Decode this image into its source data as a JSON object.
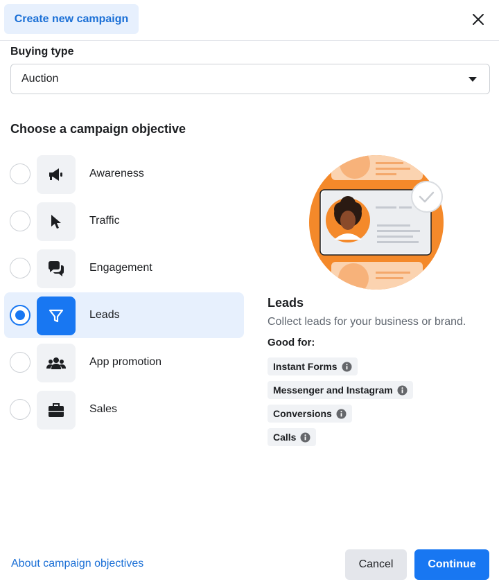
{
  "header": {
    "tab_label": "Create new campaign",
    "close_icon": "close-icon"
  },
  "buying_type": {
    "label": "Buying type",
    "value": "Auction"
  },
  "objectives": {
    "title": "Choose a campaign objective",
    "selected": "Leads",
    "items": [
      {
        "label": "Awareness",
        "icon": "megaphone-icon"
      },
      {
        "label": "Traffic",
        "icon": "cursor-icon"
      },
      {
        "label": "Engagement",
        "icon": "chat-bubbles-icon"
      },
      {
        "label": "Leads",
        "icon": "funnel-icon"
      },
      {
        "label": "App promotion",
        "icon": "people-icon"
      },
      {
        "label": "Sales",
        "icon": "briefcase-icon"
      }
    ]
  },
  "detail": {
    "title": "Leads",
    "description": "Collect leads for your business or brand.",
    "good_for_label": "Good for:",
    "good_for": [
      "Instant Forms",
      "Messenger and Instagram",
      "Conversions",
      "Calls"
    ]
  },
  "footer": {
    "about_link": "About campaign objectives",
    "cancel_label": "Cancel",
    "continue_label": "Continue"
  },
  "colors": {
    "accent": "#1877f2",
    "link": "#1a6fd6",
    "selected_bg": "#e7f0fd",
    "illustration_orange": "#f4892a"
  }
}
